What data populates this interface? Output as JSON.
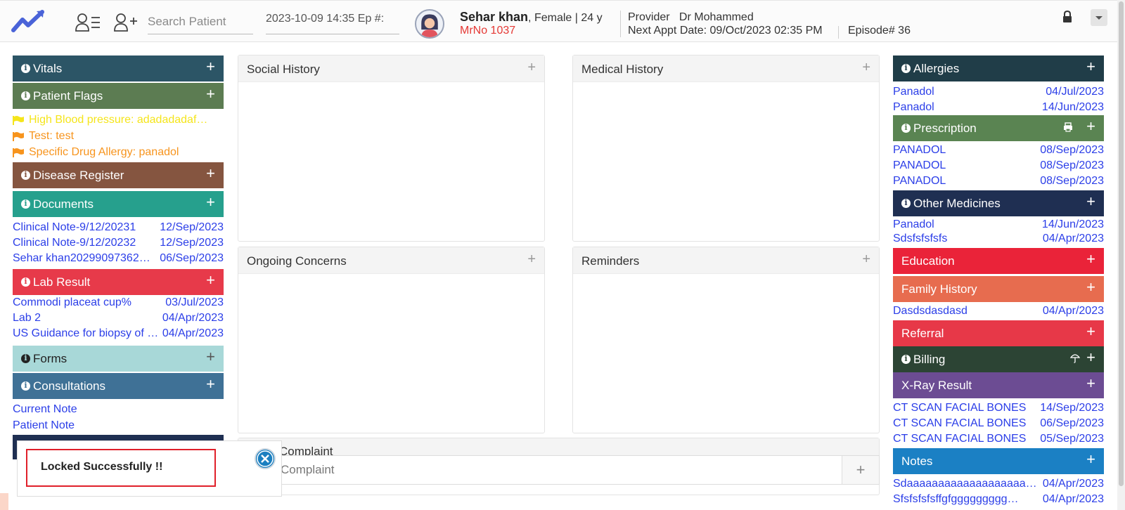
{
  "header": {
    "search_placeholder": "Search Patient",
    "episode_datetime": "2023-10-09 14:35 Ep #:",
    "patient_name": "Sehar khan",
    "patient_info": ", Female | 24 y",
    "mrno": "MrNo 1037",
    "provider_label": "Provider",
    "provider_name": "Dr Mohammed",
    "next_appt_label": "Next Appt Date:",
    "next_appt_value": "09/Oct/2023 02:35 PM",
    "episode": "Episode# 36"
  },
  "left": {
    "vitals": "Vitals",
    "patient_flags": "Patient Flags",
    "flags": [
      {
        "text": "High Blood pressure: adadadadaf…",
        "color": "#f5e51b"
      },
      {
        "text": "Test: test",
        "color": "#f7941d"
      },
      {
        "text": "Specific Drug Allergy: panadol",
        "color": "#f7941d"
      }
    ],
    "disease_register": "Disease Register",
    "documents": "Documents",
    "document_rows": [
      {
        "name": "Clinical Note-9/12/20231",
        "date": "12/Sep/2023"
      },
      {
        "name": "Clinical Note-9/12/20232",
        "date": "12/Sep/2023"
      },
      {
        "name": "Sehar khan20299097362…",
        "date": "06/Sep/2023"
      }
    ],
    "lab_result": "Lab Result",
    "lab_rows": [
      {
        "name": "Commodi placeat cup%",
        "date": "03/Jul/2023"
      },
      {
        "name": "Lab 2",
        "date": "04/Apr/2023"
      },
      {
        "name": "US Guidance for biopsy of …",
        "date": "04/Apr/2023"
      }
    ],
    "forms": "Forms",
    "consultations": "Consultations",
    "consultation_rows": [
      "Current Note",
      "Patient Note"
    ]
  },
  "center": {
    "social_history": "Social History",
    "medical_history": "Medical History",
    "ongoing_concerns": "Ongoing Concerns",
    "reminders": "Reminders",
    "complaint_title": "Complaint",
    "complaint_placeholder": "Complaint"
  },
  "right": {
    "allergies": "Allergies",
    "allergy_rows": [
      {
        "name": "Panadol",
        "date": "04/Jul/2023"
      },
      {
        "name": "Panadol",
        "date": "14/Jun/2023"
      }
    ],
    "prescription": "Prescription",
    "prescription_rows": [
      {
        "name": "PANADOL",
        "date": "08/Sep/2023"
      },
      {
        "name": "PANADOL",
        "date": "08/Sep/2023"
      },
      {
        "name": "PANADOL",
        "date": "08/Sep/2023"
      }
    ],
    "other_medicines": "Other Medicines",
    "other_medicine_rows": [
      {
        "name": "Panadol",
        "date": "14/Jun/2023"
      },
      {
        "name": "Sdsfsfsfsfs",
        "date": "04/Apr/2023"
      }
    ],
    "education": "Education",
    "family_history": "Family History",
    "family_rows": [
      {
        "name": "Dasdsdasdasd",
        "date": "04/Apr/2023"
      }
    ],
    "referral": "Referral",
    "billing": "Billing",
    "xray_result": "X-Ray Result",
    "xray_rows": [
      {
        "name": "CT SCAN FACIAL BONES",
        "date": "14/Sep/2023"
      },
      {
        "name": "CT SCAN FACIAL BONES",
        "date": "06/Sep/2023"
      },
      {
        "name": "CT SCAN FACIAL BONES",
        "date": "05/Sep/2023"
      }
    ],
    "notes": "Notes",
    "note_rows": [
      {
        "name": "Sdaaaaaaaaaaaaaaaaaaa…",
        "date": "04/Apr/2023"
      },
      {
        "name": "Sfsfsfsfsffgfggggggggg…",
        "date": "04/Apr/2023"
      }
    ]
  },
  "toast": {
    "message": "Locked Successfully !!"
  },
  "icons": {
    "plus": "+"
  },
  "colors": {
    "vitals": "#2c5566",
    "patient_flags": "#5c7c52",
    "disease_register": "#855540",
    "documents": "#26a08d",
    "lab_result": "#e73a4a",
    "forms": "#a8d8d8",
    "consultations": "#3f7196",
    "allergies": "#203d48",
    "prescription": "#5a8452",
    "other_medicines": "#1f2f52",
    "education": "#ea2339",
    "family_history": "#e76c4f",
    "referral": "#e73848",
    "billing": "#2c4434",
    "xray_result": "#6c4c93",
    "notes": "#1b80c4",
    "link": "#2b3ee8",
    "mrno": "#e53935"
  }
}
